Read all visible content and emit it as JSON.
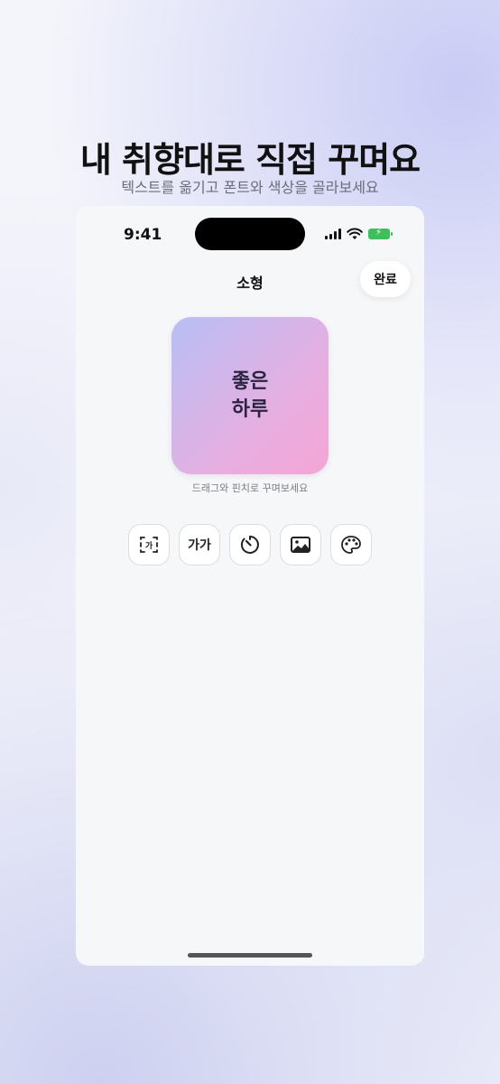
{
  "headline": "내 취향대로 직접 꾸며요",
  "subline": "텍스트를 옮기고 폰트와 색상을 골라보세요",
  "status_bar": {
    "time": "9:41"
  },
  "nav": {
    "title": "소형",
    "done_label": "완료"
  },
  "widget": {
    "line1": "좋은",
    "line2": "하루"
  },
  "hint": "드래그와 핀치로 꾸며보세요",
  "toolbar": {
    "font_size_label": "가가",
    "tools": [
      "text-box-icon",
      "font-icon",
      "clock-icon",
      "image-icon",
      "palette-icon"
    ]
  },
  "colors": {
    "widget_gradient_start": "#b7bff5",
    "widget_gradient_end": "#f4a6d5",
    "battery": "#3fbf5b"
  }
}
